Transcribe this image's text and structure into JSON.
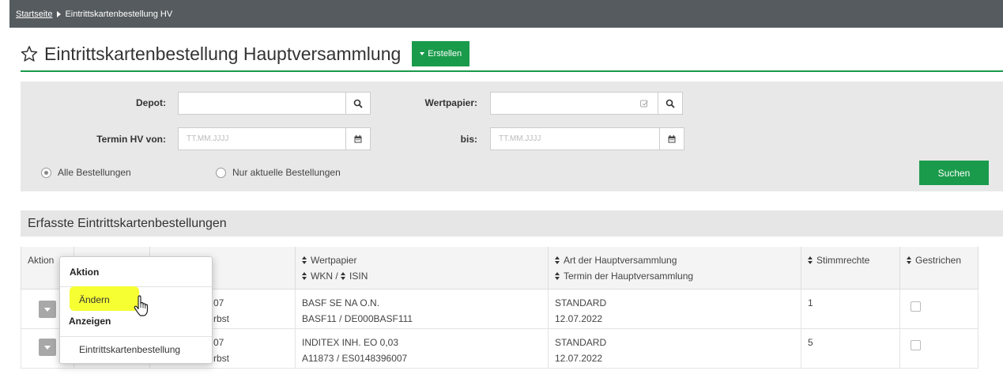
{
  "breadcrumb": {
    "home": "Startseite",
    "current": "Eintrittskartenbestellung HV"
  },
  "header": {
    "title": "Eintrittskartenbestellung Hauptversammlung",
    "create_label": "Erstellen"
  },
  "filter": {
    "depot_label": "Depot:",
    "depot_value": "",
    "wertpapier_label": "Wertpapier:",
    "wertpapier_value": "",
    "termin_von_label": "Termin HV von:",
    "termin_von_placeholder": "TT.MM.JJJJ",
    "bis_label": "bis:",
    "bis_placeholder": "TT.MM.JJJJ",
    "radio_all": "Alle Bestellungen",
    "radio_current": "Nur aktuelle Bestellungen",
    "selected_radio": "all",
    "search_label": "Suchen"
  },
  "results": {
    "title": "Erfasste Eintrittskartenbestellungen",
    "columns": {
      "aktion": "Aktion",
      "wertpapier": "Wertpapier",
      "wkn": "WKN",
      "isin": "ISIN",
      "art": "Art der Hauptversammlung",
      "termin": "Termin der Hauptversammlung",
      "stimmrechte": "Stimmrechte",
      "gestrichen": "Gestrichen"
    },
    "rows": [
      {
        "depot_frag1": "07",
        "depot_frag2": "rbst",
        "wertpapier": "BASF SE NA O.N.",
        "wkn_isin": "BASF11 / DE000BASF111",
        "art": "STANDARD",
        "termin": "12.07.2022",
        "stimmrechte": "1",
        "gestrichen": false
      },
      {
        "depot_frag1": "07",
        "depot_frag2": "rbst",
        "wertpapier": "INDITEX INH. EO 0,03",
        "wkn_isin": "A11873 / ES0148396007",
        "art": "STANDARD",
        "termin": "12.07.2022",
        "stimmrechte": "5",
        "gestrichen": false
      }
    ]
  },
  "menu": {
    "section1": "Aktion",
    "item_edit": "Ändern",
    "section2": "Anzeigen",
    "item_view": "Eintrittskartenbestellung"
  },
  "colors": {
    "accent": "#1a9b4b",
    "topbar": "#555b5f",
    "highlight": "#f5ff1c"
  }
}
